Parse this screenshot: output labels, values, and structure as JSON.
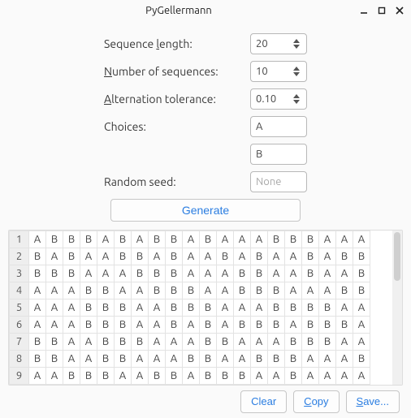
{
  "window": {
    "title": "PyGellermann"
  },
  "form": {
    "seq_len": {
      "label_pre": "Sequence ",
      "label_u": "l",
      "label_post": "ength:",
      "value": "20"
    },
    "num_seq": {
      "label_u": "N",
      "label_post": "umber of sequences:",
      "value": "10"
    },
    "alt_tol": {
      "label_u": "A",
      "label_post": "lternation tolerance:",
      "value": "0.10"
    },
    "choices": {
      "label": "Choices:",
      "value_a": "A",
      "value_b": "B"
    },
    "seed": {
      "label": "Random seed:",
      "placeholder": "None"
    }
  },
  "buttons": {
    "generate": "Generate",
    "clear": "Clear",
    "copy_u": "C",
    "copy_post": "opy",
    "save_u": "S",
    "save_post": "ave..."
  },
  "table": {
    "rows": [
      {
        "n": "1",
        "cells": [
          "A",
          "B",
          "B",
          "B",
          "A",
          "B",
          "A",
          "B",
          "B",
          "A",
          "B",
          "A",
          "A",
          "A",
          "B",
          "B",
          "B",
          "A",
          "A",
          "A"
        ]
      },
      {
        "n": "2",
        "cells": [
          "B",
          "A",
          "B",
          "A",
          "A",
          "B",
          "B",
          "A",
          "B",
          "A",
          "A",
          "B",
          "A",
          "B",
          "A",
          "A",
          "B",
          "A",
          "B",
          "B"
        ]
      },
      {
        "n": "3",
        "cells": [
          "B",
          "B",
          "B",
          "A",
          "A",
          "A",
          "B",
          "B",
          "B",
          "A",
          "A",
          "A",
          "B",
          "B",
          "A",
          "A",
          "B",
          "A",
          "A",
          "B"
        ]
      },
      {
        "n": "4",
        "cells": [
          "A",
          "A",
          "A",
          "B",
          "B",
          "A",
          "A",
          "B",
          "B",
          "B",
          "A",
          "A",
          "B",
          "B",
          "B",
          "A",
          "A",
          "A",
          "B",
          "B"
        ]
      },
      {
        "n": "5",
        "cells": [
          "A",
          "A",
          "A",
          "B",
          "B",
          "B",
          "A",
          "A",
          "B",
          "B",
          "B",
          "A",
          "A",
          "A",
          "B",
          "B",
          "B",
          "B",
          "A",
          "A"
        ]
      },
      {
        "n": "6",
        "cells": [
          "A",
          "A",
          "A",
          "B",
          "B",
          "B",
          "A",
          "A",
          "B",
          "A",
          "B",
          "A",
          "B",
          "B",
          "B",
          "A",
          "B",
          "B",
          "B",
          "A"
        ]
      },
      {
        "n": "7",
        "cells": [
          "B",
          "B",
          "A",
          "A",
          "B",
          "B",
          "B",
          "A",
          "A",
          "A",
          "B",
          "B",
          "A",
          "A",
          "A",
          "B",
          "B",
          "B",
          "A",
          "A"
        ]
      },
      {
        "n": "8",
        "cells": [
          "B",
          "B",
          "A",
          "A",
          "B",
          "B",
          "A",
          "A",
          "A",
          "B",
          "B",
          "A",
          "A",
          "B",
          "B",
          "B",
          "A",
          "A",
          "A",
          "B"
        ]
      },
      {
        "n": "9",
        "cells": [
          "A",
          "A",
          "B",
          "B",
          "B",
          "A",
          "A",
          "B",
          "B",
          "A",
          "B",
          "B",
          "B",
          "A",
          "A",
          "B",
          "A",
          "A",
          "A",
          "A"
        ]
      }
    ]
  }
}
